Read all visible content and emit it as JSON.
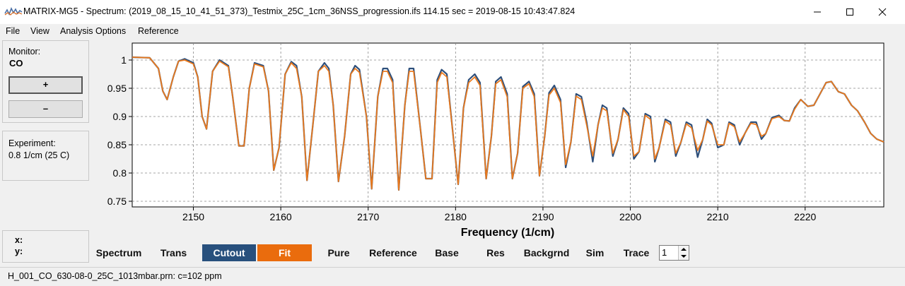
{
  "window": {
    "title": "MATRIX-MG5 - Spectrum: (2019_08_15_10_41_51_373)_Testmix_25C_1cm_36NSS_progression.ifs 114.15 sec = 2019-08-15 10:43:47.824"
  },
  "menu": [
    "File",
    "View",
    "Analysis Options",
    "Reference"
  ],
  "monitor": {
    "label": "Monitor:",
    "value": "CO",
    "plus_label": "+",
    "minus_label": "–"
  },
  "experiment": {
    "label": "Experiment:",
    "value": "0.8 1/cm (25 C)"
  },
  "cursor": {
    "x_label": "x:",
    "y_label": "y:"
  },
  "tabs": {
    "items": [
      {
        "label": "Spectrum"
      },
      {
        "label": "Trans"
      },
      {
        "label": "Cutout"
      },
      {
        "label": "Fit"
      },
      {
        "label": "Pure"
      },
      {
        "label": "Reference"
      },
      {
        "label": "Base"
      },
      {
        "label": "Res"
      },
      {
        "label": "Backgrnd"
      },
      {
        "label": "Sim"
      },
      {
        "label": "Trace"
      }
    ],
    "trace_value": "1"
  },
  "status": {
    "text": "H_001_CO_630-08-0_25C_1013mbar.prn: c=102 ppm"
  },
  "colors": {
    "measured": "#2e4f7a",
    "fit": "#ea7a1e",
    "cutout_tab": "#28507d",
    "fit_tab": "#ea6c0d"
  },
  "chart_data": {
    "type": "line",
    "xlabel": "Frequency (1/cm)",
    "ylabel": "",
    "xlim": [
      2143,
      2229
    ],
    "ylim": [
      0.74,
      1.03
    ],
    "x_ticks": [
      2150,
      2160,
      2170,
      2180,
      2190,
      2200,
      2210,
      2220
    ],
    "y_ticks": [
      0.75,
      0.8,
      0.85,
      0.9,
      0.95,
      1
    ],
    "grid": true,
    "series": [
      {
        "color": "#2e4f7a",
        "x": [
          2143.0,
          2145.0,
          2146.0,
          2146.5,
          2147.0,
          2147.7,
          2148.3,
          2149.0,
          2150.0,
          2150.5,
          2151.0,
          2151.5,
          2152.2,
          2153.0,
          2154.0,
          2154.5,
          2155.2,
          2155.8,
          2156.4,
          2157.0,
          2158.0,
          2158.6,
          2159.2,
          2159.8,
          2160.5,
          2161.2,
          2161.8,
          2162.4,
          2163.0,
          2163.7,
          2164.3,
          2165.0,
          2165.5,
          2166.0,
          2166.6,
          2167.3,
          2168.0,
          2168.5,
          2169.0,
          2169.8,
          2170.4,
          2171.1,
          2171.7,
          2172.2,
          2172.8,
          2173.5,
          2174.2,
          2174.7,
          2175.2,
          2176.0,
          2176.6,
          2177.3,
          2177.9,
          2178.4,
          2179.0,
          2179.7,
          2180.3,
          2180.9,
          2181.5,
          2182.2,
          2182.8,
          2183.5,
          2184.1,
          2184.6,
          2185.2,
          2185.9,
          2186.5,
          2187.1,
          2187.7,
          2188.4,
          2189.0,
          2189.6,
          2190.2,
          2190.7,
          2191.3,
          2192.0,
          2192.6,
          2193.2,
          2193.8,
          2194.4,
          2195.0,
          2195.7,
          2196.3,
          2196.8,
          2197.3,
          2198.0,
          2198.6,
          2199.2,
          2199.8,
          2200.4,
          2201.0,
          2201.7,
          2202.3,
          2202.8,
          2203.3,
          2204.0,
          2204.6,
          2205.2,
          2205.8,
          2206.4,
          2207.0,
          2207.7,
          2208.3,
          2208.8,
          2209.3,
          2210.0,
          2210.7,
          2211.3,
          2211.9,
          2212.5,
          2213.1,
          2213.8,
          2214.4,
          2215.0,
          2215.5,
          2216.2,
          2217.0,
          2217.6,
          2218.2,
          2218.8,
          2219.5,
          2220.3,
          2221.0,
          2221.7,
          2222.4,
          2223.0,
          2223.8,
          2224.5,
          2225.3,
          2226.0,
          2226.8,
          2227.5,
          2228.2,
          2229.0
        ],
        "y": [
          1.005,
          1.004,
          0.985,
          0.945,
          0.93,
          0.97,
          0.998,
          1.002,
          0.995,
          0.97,
          0.9,
          0.878,
          0.98,
          1.0,
          0.99,
          0.935,
          0.848,
          0.848,
          0.95,
          0.995,
          0.99,
          0.945,
          0.805,
          0.845,
          0.975,
          0.997,
          0.99,
          0.935,
          0.787,
          0.89,
          0.98,
          0.995,
          0.985,
          0.92,
          0.785,
          0.865,
          0.975,
          0.99,
          0.983,
          0.9,
          0.772,
          0.935,
          0.985,
          0.985,
          0.965,
          0.77,
          0.92,
          0.985,
          0.985,
          0.875,
          0.79,
          0.79,
          0.965,
          0.983,
          0.975,
          0.87,
          0.78,
          0.915,
          0.965,
          0.975,
          0.96,
          0.79,
          0.865,
          0.962,
          0.97,
          0.94,
          0.79,
          0.835,
          0.953,
          0.962,
          0.94,
          0.795,
          0.865,
          0.942,
          0.955,
          0.93,
          0.81,
          0.855,
          0.94,
          0.935,
          0.89,
          0.82,
          0.885,
          0.92,
          0.915,
          0.83,
          0.86,
          0.915,
          0.905,
          0.825,
          0.838,
          0.905,
          0.9,
          0.82,
          0.845,
          0.895,
          0.89,
          0.83,
          0.855,
          0.89,
          0.885,
          0.828,
          0.86,
          0.895,
          0.888,
          0.845,
          0.85,
          0.89,
          0.885,
          0.85,
          0.87,
          0.89,
          0.89,
          0.86,
          0.87,
          0.898,
          0.902,
          0.893,
          0.892,
          0.915,
          0.93,
          0.918,
          0.92,
          0.94,
          0.96,
          0.962,
          0.944,
          0.94,
          0.92,
          0.91,
          0.89,
          0.87,
          0.86,
          0.855
        ]
      },
      {
        "color": "#ea7a1e",
        "x": [
          2143.0,
          2145.0,
          2146.0,
          2146.5,
          2147.0,
          2147.7,
          2148.3,
          2149.0,
          2150.0,
          2150.5,
          2151.0,
          2151.5,
          2152.2,
          2153.0,
          2154.0,
          2154.5,
          2155.2,
          2155.8,
          2156.4,
          2157.0,
          2158.0,
          2158.6,
          2159.2,
          2159.8,
          2160.5,
          2161.2,
          2161.8,
          2162.4,
          2163.0,
          2163.7,
          2164.3,
          2165.0,
          2165.5,
          2166.0,
          2166.6,
          2167.3,
          2168.0,
          2168.5,
          2169.0,
          2169.8,
          2170.4,
          2171.1,
          2171.7,
          2172.2,
          2172.8,
          2173.5,
          2174.2,
          2174.7,
          2175.2,
          2176.0,
          2176.6,
          2177.3,
          2177.9,
          2178.4,
          2179.0,
          2179.7,
          2180.3,
          2180.9,
          2181.5,
          2182.2,
          2182.8,
          2183.5,
          2184.1,
          2184.6,
          2185.2,
          2185.9,
          2186.5,
          2187.1,
          2187.7,
          2188.4,
          2189.0,
          2189.6,
          2190.2,
          2190.7,
          2191.3,
          2192.0,
          2192.6,
          2193.2,
          2193.8,
          2194.4,
          2195.0,
          2195.7,
          2196.3,
          2196.8,
          2197.3,
          2198.0,
          2198.6,
          2199.2,
          2199.8,
          2200.4,
          2201.0,
          2201.7,
          2202.3,
          2202.8,
          2203.3,
          2204.0,
          2204.6,
          2205.2,
          2205.8,
          2206.4,
          2207.0,
          2207.7,
          2208.3,
          2208.8,
          2209.3,
          2210.0,
          2210.7,
          2211.3,
          2211.9,
          2212.5,
          2213.1,
          2213.8,
          2214.4,
          2215.0,
          2215.5,
          2216.2,
          2217.0,
          2217.6,
          2218.2,
          2218.8,
          2219.5,
          2220.3,
          2221.0,
          2221.7,
          2222.4,
          2223.0,
          2223.8,
          2224.5,
          2225.3,
          2226.0,
          2226.8,
          2227.5,
          2228.2,
          2229.0
        ],
        "y": [
          1.005,
          1.004,
          0.985,
          0.945,
          0.93,
          0.97,
          0.998,
          1.0,
          0.993,
          0.97,
          0.9,
          0.878,
          0.98,
          0.998,
          0.988,
          0.935,
          0.848,
          0.848,
          0.95,
          0.993,
          0.988,
          0.945,
          0.805,
          0.845,
          0.975,
          0.995,
          0.985,
          0.935,
          0.787,
          0.89,
          0.98,
          0.99,
          0.98,
          0.92,
          0.785,
          0.865,
          0.975,
          0.985,
          0.978,
          0.9,
          0.772,
          0.935,
          0.98,
          0.98,
          0.96,
          0.77,
          0.92,
          0.98,
          0.98,
          0.875,
          0.79,
          0.79,
          0.96,
          0.978,
          0.97,
          0.87,
          0.78,
          0.915,
          0.96,
          0.97,
          0.955,
          0.79,
          0.865,
          0.958,
          0.965,
          0.935,
          0.79,
          0.835,
          0.95,
          0.958,
          0.935,
          0.795,
          0.865,
          0.938,
          0.95,
          0.925,
          0.815,
          0.855,
          0.936,
          0.93,
          0.885,
          0.83,
          0.885,
          0.915,
          0.91,
          0.835,
          0.86,
          0.912,
          0.9,
          0.83,
          0.838,
          0.902,
          0.895,
          0.825,
          0.845,
          0.892,
          0.885,
          0.835,
          0.855,
          0.887,
          0.88,
          0.84,
          0.86,
          0.892,
          0.885,
          0.85,
          0.85,
          0.888,
          0.882,
          0.855,
          0.87,
          0.888,
          0.886,
          0.865,
          0.87,
          0.896,
          0.9,
          0.893,
          0.892,
          0.913,
          0.93,
          0.918,
          0.92,
          0.94,
          0.96,
          0.962,
          0.944,
          0.94,
          0.92,
          0.91,
          0.89,
          0.87,
          0.86,
          0.855
        ]
      }
    ]
  }
}
